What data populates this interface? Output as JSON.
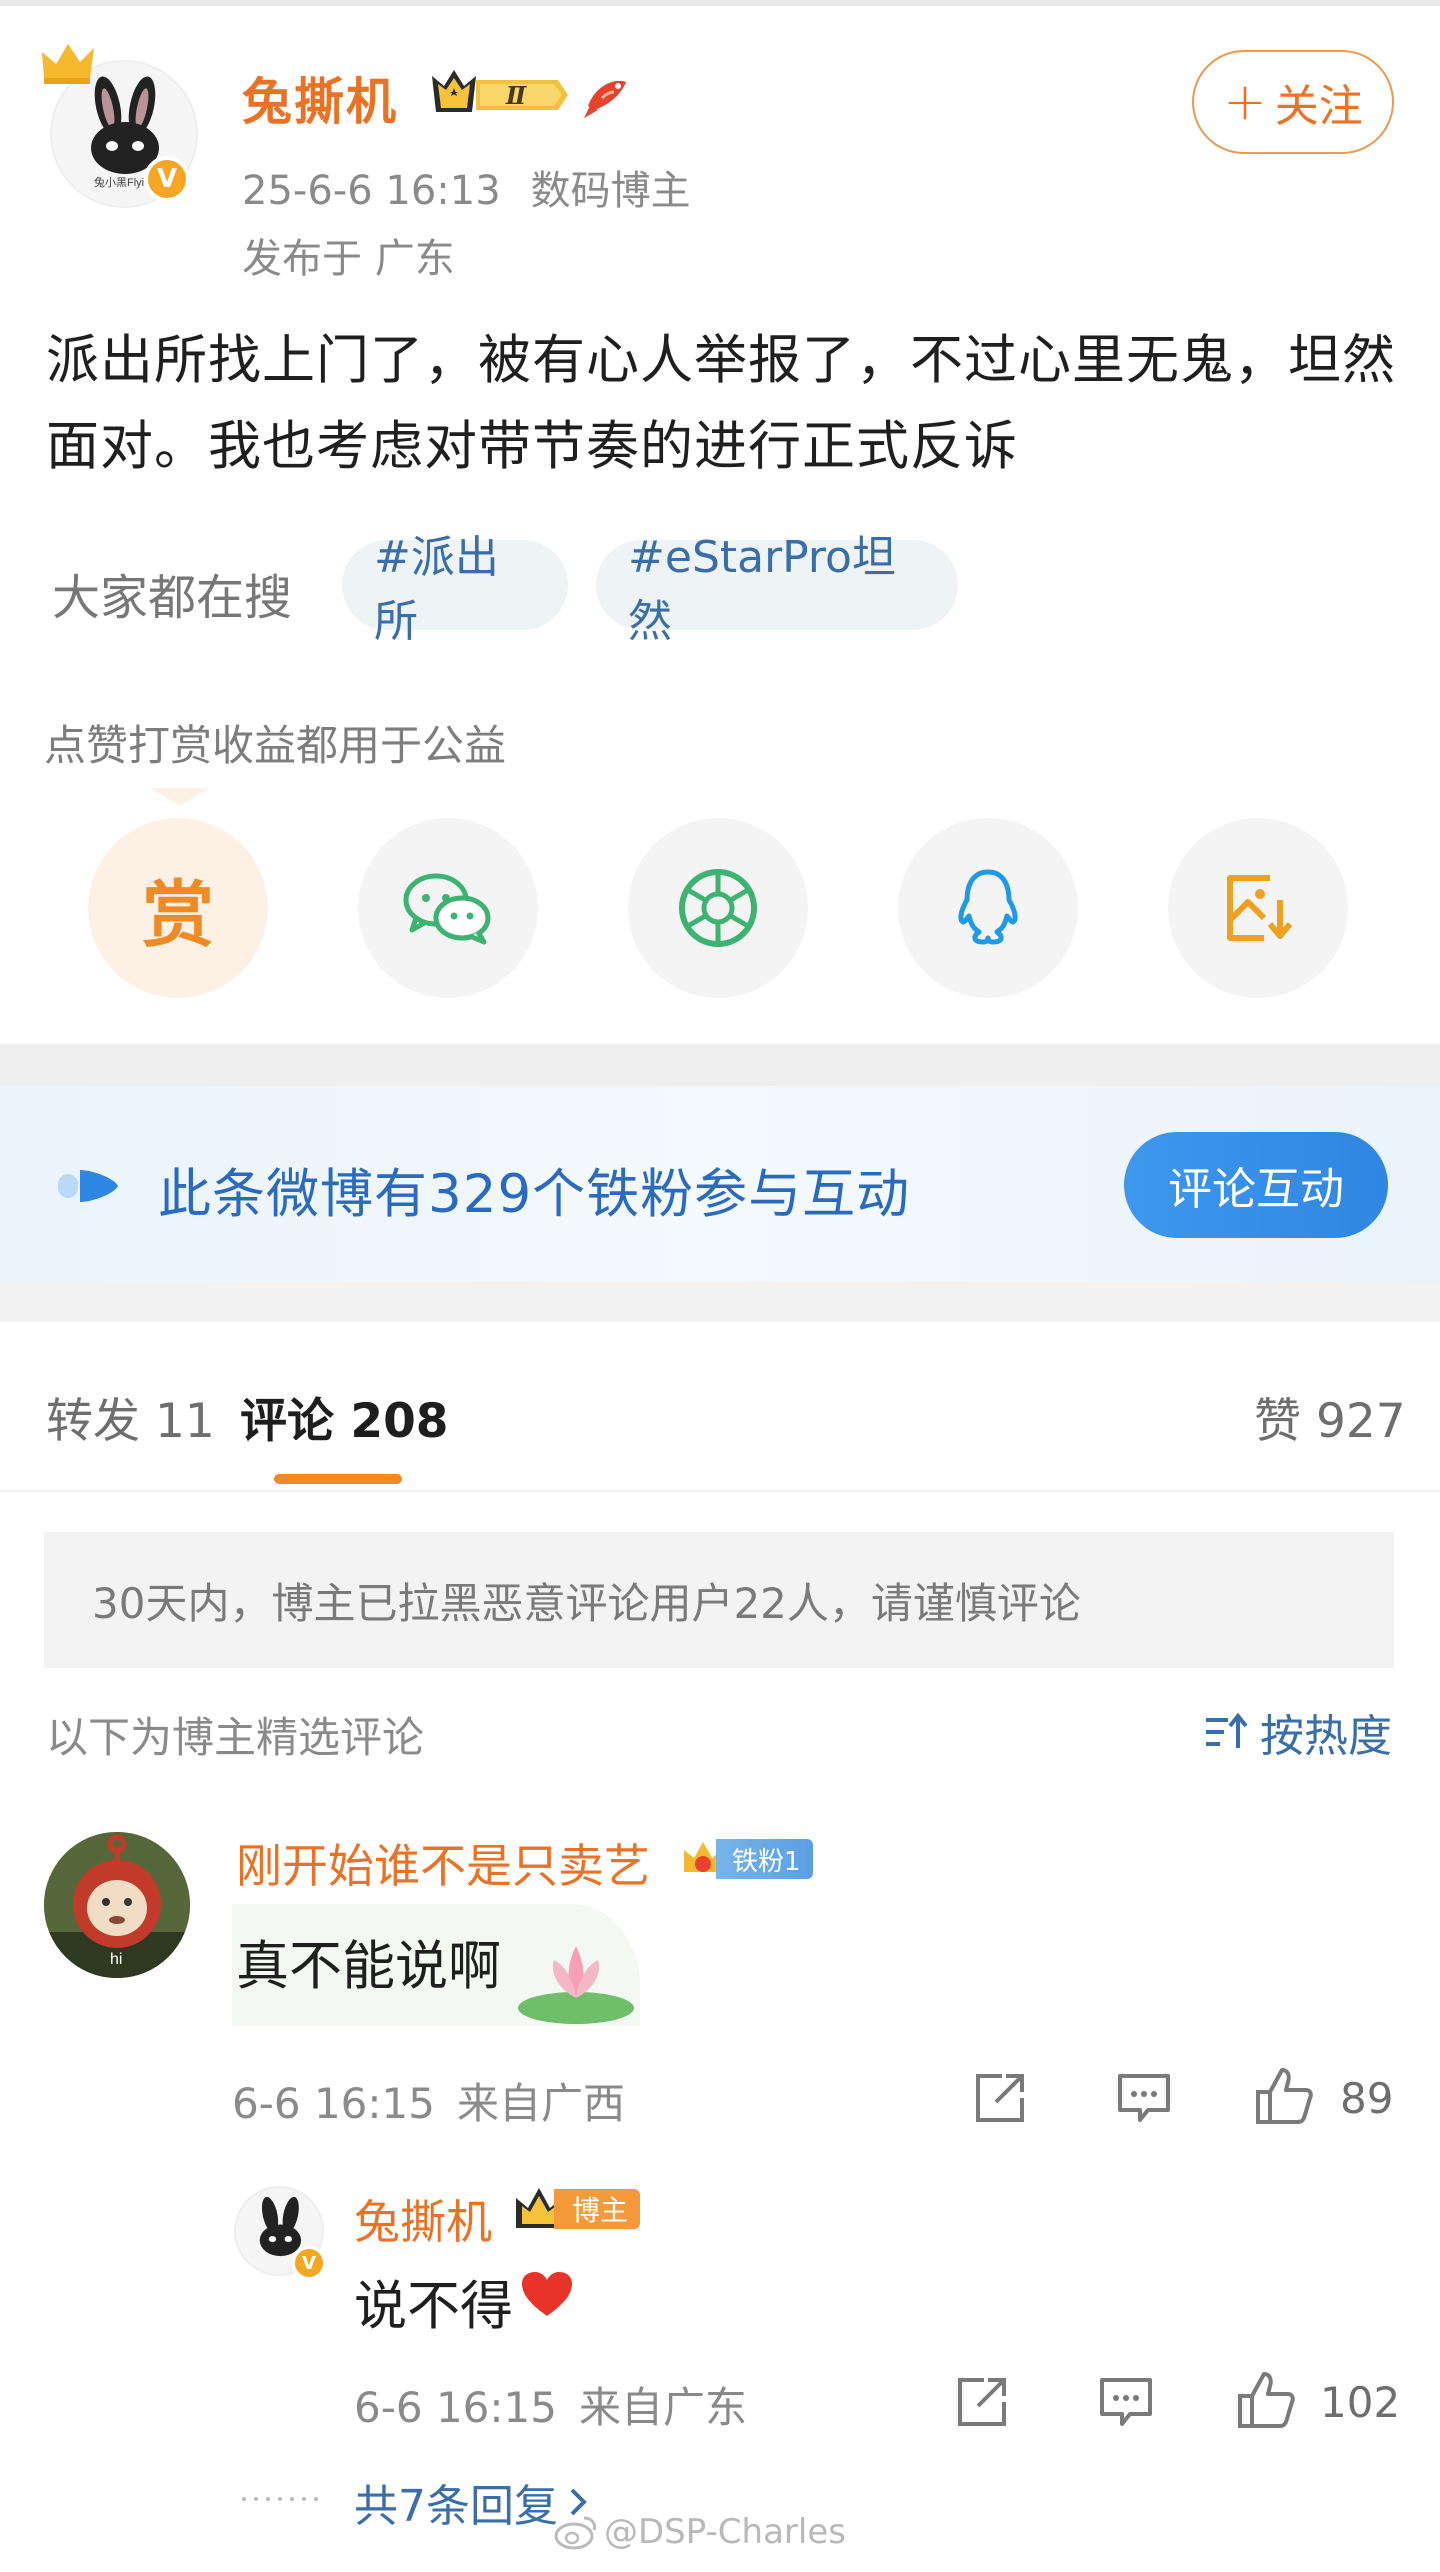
{
  "post": {
    "author": "兔撕机",
    "level_badge": "Ⅱ",
    "time": "25-6-6 16:13",
    "category": "数码博主",
    "location": "发布于 广东",
    "follow_label": "关注",
    "follow_plus": "+",
    "avatar_caption": "兔小黑Flyi",
    "verified_mark": "V",
    "text": "派出所找上门了，被有心人举报了，不过心里无鬼，坦然面对。我也考虑对带节奏的进行正式反诉"
  },
  "search": {
    "label": "大家都在搜",
    "tags": [
      "#派出所",
      "#eStarPro坦然"
    ]
  },
  "charity_note": "点赞打赏收益都用于公益",
  "share": {
    "reward_glyph": "赏",
    "items": [
      "reward",
      "wechat",
      "moments",
      "qq",
      "save-image"
    ]
  },
  "fan_banner": {
    "text": "此条微博有329个铁粉参与互动",
    "button": "评论互动"
  },
  "tabs": {
    "forward": "转发 11",
    "comment": "评论 208",
    "like": "赞 927"
  },
  "notice": "30天内，博主已拉黑恶意评论用户22人，请谨慎评论",
  "selected_label": "以下为博主精选评论",
  "sort_label": "按热度",
  "comments": [
    {
      "name": "刚开始谁不是只卖艺",
      "badge": "铁粉1",
      "avatar_caption": "hi",
      "text": "真不能说啊",
      "time": "6-6 16:15",
      "location": "来自广西",
      "likes": "89",
      "reply": {
        "name": "兔撕机",
        "badge": "博主",
        "text": "说不得",
        "time": "6-6 16:15",
        "location": "来自广东",
        "likes": "102"
      },
      "more_replies": "共7条回复"
    }
  ],
  "watermark": "@DSP-Charles",
  "colors": {
    "accent_orange": "#eb7125",
    "link_blue": "#3a6ea8",
    "fan_blue": "#2f86e3"
  }
}
